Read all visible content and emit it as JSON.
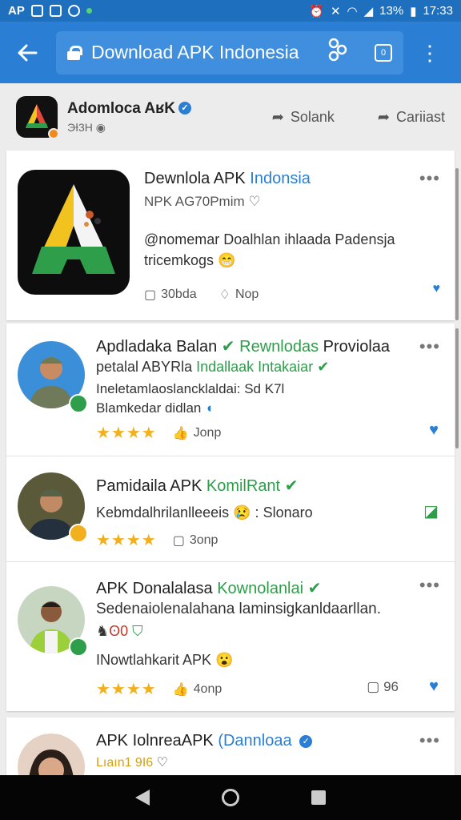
{
  "status": {
    "left_text": "AP",
    "battery": "13%",
    "time": "17:33",
    "icons": [
      "gallery-icon",
      "message-icon",
      "sync-icon",
      "notification-dot-icon",
      "alarm-icon",
      "mute-icon",
      "wifi-icon",
      "signal-icon"
    ]
  },
  "appbar": {
    "url": "Download APK Indonesia",
    "tabs_count": "0"
  },
  "publisher": {
    "name": "Adomloca AʁK",
    "sub": "ЭƗ3H",
    "action1": "Solank",
    "action2": "Cariiast"
  },
  "featured": {
    "title_prefix": "Dewnlola APK ",
    "title_blue": "Indonsia",
    "subtitle": "NPK AG70Pmim",
    "description": "@nomemar Doalhlan ihlaada Padensja tricemkogs",
    "stat1": "30bda",
    "stat2": "Nop"
  },
  "items": [
    {
      "title_a": "Apdladaka Balan",
      "title_green": "Rewnlodas",
      "title_b": "Proviolaa",
      "line2_a": "petalal ABYRla",
      "line2_green": "Indallaak Intakaiar",
      "line3": "Ineletamlaoslancklaldai: Sd K7l",
      "line4": "Blamkedar didlan",
      "rating": "★★★★",
      "likes": "Jonp"
    },
    {
      "title_a": "Pamidaila APK",
      "title_green": "KomilRant",
      "line2": "Kebmdalhrilanlleeeis",
      "line2_b": "Slonaro",
      "rating": "★★★★",
      "likes": "3onp"
    },
    {
      "title_a": "APK Donalalasa",
      "title_green": "Kownolanlai",
      "line2": "Sedenaiolenalahana laminsigkanldaarllan.",
      "line3": "ʘ0",
      "line4": "INowtlahkarit APK",
      "rating": "★★★★",
      "likes": "4onp",
      "comments": "96"
    },
    {
      "title_a": "APK IolnreaAPK",
      "title_blue": "(Dannloaa",
      "line2": "Lıaın1 9I6"
    }
  ],
  "colors": {
    "primary": "#2a7fd4",
    "statusbar": "#1f6fbf",
    "green": "#2e9e4a",
    "star": "#f2b01e"
  }
}
